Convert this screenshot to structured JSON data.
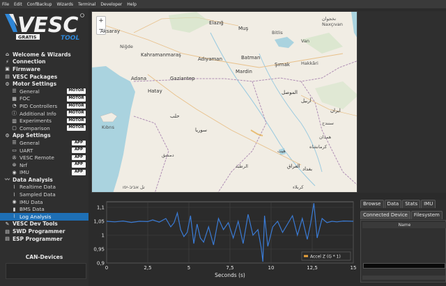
{
  "menu": [
    "File",
    "Edit",
    "ConfBackup",
    "Wizards",
    "Terminal",
    "Developer",
    "Help"
  ],
  "logo": {
    "main": "VESC",
    "sub": "TOOL",
    "badge": "GRATIS",
    "accent": "#2f86d6"
  },
  "nav": [
    {
      "type": "top",
      "label": "Welcome & Wizards",
      "icon": "home-icon"
    },
    {
      "type": "top",
      "label": "Connection",
      "icon": "plug-icon"
    },
    {
      "type": "top",
      "label": "Firmware",
      "icon": "chip-icon"
    },
    {
      "type": "top",
      "label": "VESC Packages",
      "icon": "package-icon"
    },
    {
      "type": "top",
      "label": "Motor Settings",
      "icon": "motor-icon"
    },
    {
      "type": "sub",
      "label": "General",
      "icon": "sliders-icon",
      "badge": "MOTOR"
    },
    {
      "type": "sub",
      "label": "FOC",
      "icon": "foc-icon",
      "badge": "MOTOR"
    },
    {
      "type": "sub",
      "label": "PID Controllers",
      "icon": "pid-icon",
      "badge": "MOTOR"
    },
    {
      "type": "sub",
      "label": "Additional Info",
      "icon": "info-icon",
      "badge": "MOTOR"
    },
    {
      "type": "sub",
      "label": "Experiments",
      "icon": "experiment-icon",
      "badge": "MOTOR"
    },
    {
      "type": "sub",
      "label": "Comparison",
      "icon": "compare-icon",
      "badge": "MOTOR"
    },
    {
      "type": "top",
      "label": "App Settings",
      "icon": "app-icon"
    },
    {
      "type": "sub",
      "label": "General",
      "icon": "sliders-icon",
      "badge": "APP"
    },
    {
      "type": "sub",
      "label": "UART",
      "icon": "uart-icon",
      "badge": "APP"
    },
    {
      "type": "sub",
      "label": "VESC Remote",
      "icon": "remote-icon",
      "badge": "APP"
    },
    {
      "type": "sub",
      "label": "Nrf",
      "icon": "wireless-icon",
      "badge": "APP"
    },
    {
      "type": "sub",
      "label": "IMU",
      "icon": "imu-icon",
      "badge": "APP"
    },
    {
      "type": "top",
      "label": "Data Analysis",
      "icon": "analysis-icon"
    },
    {
      "type": "sub",
      "label": "Realtime Data",
      "icon": "realtime-icon"
    },
    {
      "type": "sub",
      "label": "Sampled Data",
      "icon": "sampled-icon"
    },
    {
      "type": "sub",
      "label": "IMU Data",
      "icon": "imu-icon"
    },
    {
      "type": "sub",
      "label": "BMS Data",
      "icon": "battery-icon"
    },
    {
      "type": "sub",
      "label": "Log Analysis",
      "icon": "log-icon",
      "selected": true
    },
    {
      "type": "top",
      "label": "VESC Dev Tools",
      "icon": "dev-icon"
    },
    {
      "type": "top",
      "label": "SWD Programmer",
      "icon": "swd-icon"
    },
    {
      "type": "top",
      "label": "ESP Programmer",
      "icon": "esp-icon"
    }
  ],
  "can": {
    "title": "CAN-Devices"
  },
  "map": {
    "zoom_in": "+",
    "zoom_out": "−",
    "labels": [
      {
        "text": "Elazığ",
        "city": true
      },
      {
        "text": "Muş",
        "city": true
      },
      {
        "text": "Bitlis"
      },
      {
        "text": "Aksaray",
        "city": true
      },
      {
        "text": "Niğde"
      },
      {
        "text": "Kahramanmaraş",
        "city": true
      },
      {
        "text": "Adıyaman",
        "city": true
      },
      {
        "text": "Batman",
        "city": true
      },
      {
        "text": "Şırnak",
        "city": true
      },
      {
        "text": "Hakkâri"
      },
      {
        "text": "Adana",
        "city": true
      },
      {
        "text": "Gaziantep",
        "city": true
      },
      {
        "text": "Mardin",
        "city": true
      },
      {
        "text": "Hatay",
        "city": true
      },
      {
        "text": "Kıbrıs"
      },
      {
        "text": "الموصل",
        "city": true
      },
      {
        "text": "أربيل",
        "city": true
      },
      {
        "text": "حلب",
        "city": true
      },
      {
        "text": "سوريا",
        "city": true
      },
      {
        "text": "دمشق"
      },
      {
        "text": "العراق",
        "city": true
      },
      {
        "text": "بغداد",
        "city": true
      },
      {
        "text": "الرطبة"
      },
      {
        "text": "كربلاء"
      },
      {
        "text": "هيت"
      },
      {
        "text": "ایران",
        "city": true
      },
      {
        "text": "سنندج"
      },
      {
        "text": "همدان"
      },
      {
        "text": "کرمانشاه"
      },
      {
        "text": "نخجوان"
      },
      {
        "text": "تل אביב-יפו"
      },
      {
        "text": "Naxçıvan"
      },
      {
        "text": "Van"
      }
    ]
  },
  "plot": {
    "series_name": "Accel Z (G * 1)",
    "xlabel": "Seconds (s)",
    "line_color": "#3a7bd5",
    "legend_indicator": "#e9a23b"
  },
  "chart_data": {
    "type": "line",
    "title": "",
    "xlabel": "Seconds (s)",
    "ylabel": "",
    "xlim": [
      0,
      15
    ],
    "ylim": [
      0.9,
      1.12
    ],
    "x_ticks": [
      "0",
      "2,5",
      "5",
      "7,5",
      "10",
      "12,5",
      "15"
    ],
    "y_ticks": [
      "0,9",
      "0,95",
      "1",
      "1,05",
      "1,1"
    ],
    "grid": true,
    "legend": "bottom-right",
    "series": [
      {
        "name": "Accel Z (G * 1)",
        "x": [
          0,
          0.5,
          1,
          1.5,
          2,
          2.5,
          2.8,
          3.2,
          3.6,
          3.9,
          4.1,
          4.3,
          4.5,
          4.7,
          4.9,
          5.1,
          5.3,
          5.5,
          5.7,
          5.9,
          6.2,
          6.5,
          6.8,
          7.1,
          7.4,
          7.7,
          8.0,
          8.3,
          8.6,
          8.9,
          9.2,
          9.4,
          9.5,
          9.6,
          9.8,
          10.1,
          10.4,
          10.7,
          11.0,
          11.3,
          11.6,
          11.9,
          12.2,
          12.4,
          12.6,
          12.8,
          13.1,
          13.4,
          13.7,
          14.0,
          14.4,
          15.0
        ],
        "y": [
          1.05,
          1.048,
          1.051,
          1.046,
          1.05,
          1.049,
          1.055,
          1.047,
          1.06,
          1.03,
          1.045,
          1.08,
          1.02,
          0.995,
          1.01,
          1.07,
          0.97,
          1.04,
          0.99,
          0.975,
          1.03,
          0.965,
          1.06,
          1.02,
          1.045,
          0.99,
          1.05,
          0.97,
          1.075,
          1.0,
          1.02,
          0.955,
          0.905,
          1.07,
          0.96,
          1.03,
          1.05,
          1.01,
          1.04,
          1.07,
          1.0,
          1.06,
          0.985,
          1.04,
          1.115,
          0.99,
          1.06,
          1.045,
          1.05,
          1.048,
          1.051,
          1.05
        ]
      }
    ]
  },
  "panel": {
    "tabs": [
      {
        "label": "Browse"
      },
      {
        "label": "Data"
      },
      {
        "label": "Stats"
      },
      {
        "label": "IMU"
      }
    ],
    "tabs2": [
      {
        "label": "Connected Device",
        "active": true
      },
      {
        "label": "Filesystem"
      }
    ],
    "column_header": "Name"
  }
}
